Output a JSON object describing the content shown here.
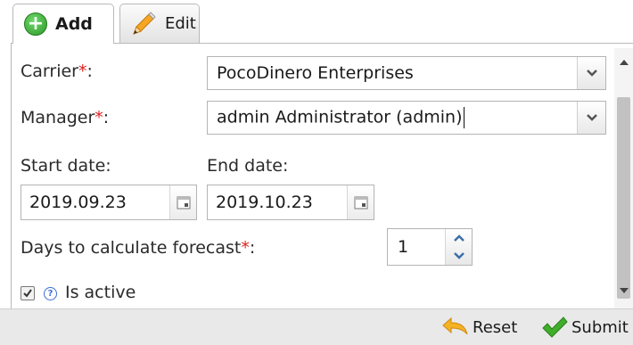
{
  "tabs": [
    {
      "label": "Add",
      "icon": "plus-circle-icon",
      "active": true
    },
    {
      "label": "Edit",
      "icon": "pencil-icon",
      "active": false
    }
  ],
  "form": {
    "carrier": {
      "label": "Carrier",
      "required_mark": "*",
      "suffix": ":",
      "value": "PocoDinero Enterprises"
    },
    "manager": {
      "label": "Manager",
      "required_mark": "*",
      "suffix": ":",
      "value": "admin Administrator (admin)"
    },
    "start_date": {
      "label": "Start date:",
      "value": "2019.09.23"
    },
    "end_date": {
      "label": "End date:",
      "value": "2019.10.23"
    },
    "forecast_days": {
      "label": "Days to calculate forecast",
      "required_mark": "*",
      "suffix": ":",
      "value": "1"
    },
    "is_active": {
      "label": "Is active",
      "checked": true
    }
  },
  "footer": {
    "reset_label": "Reset",
    "submit_label": "Submit"
  },
  "colors": {
    "required": "#e02020",
    "accent_green": "#2d9a29",
    "help_blue": "#3a6fd8"
  }
}
